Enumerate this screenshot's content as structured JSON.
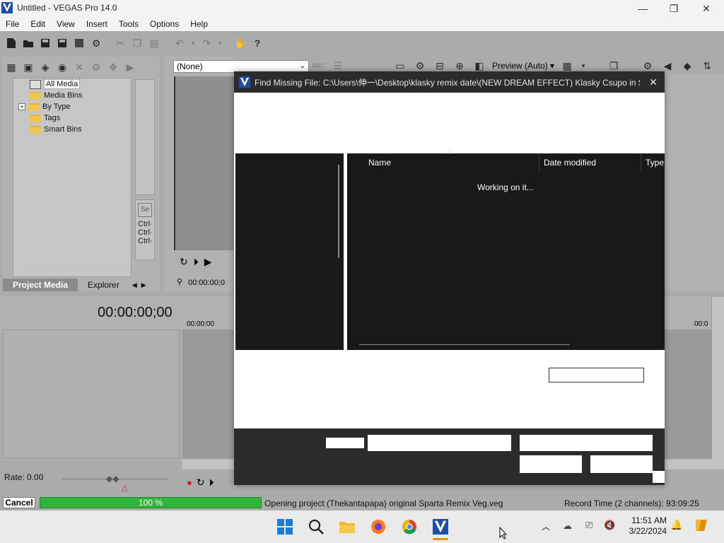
{
  "window": {
    "title": "Untitled - VEGAS Pro 14.0",
    "minimize": "—",
    "maximize": "❐",
    "close": "✕"
  },
  "menu": [
    "File",
    "Edit",
    "View",
    "Insert",
    "Tools",
    "Options",
    "Help"
  ],
  "project_media": {
    "tree": [
      "All Media",
      "Media Bins",
      "By Type",
      "Tags",
      "Smart Bins"
    ],
    "expander": "+",
    "tabs": [
      "Project Media",
      "Explorer"
    ],
    "ctrl_labels": [
      "Ctrl·",
      "Ctrl·",
      "Ctrl·"
    ]
  },
  "preview": {
    "select_value": "(None)",
    "time": "00:00:00;0",
    "mode_label": "Preview (Auto)"
  },
  "timeline": {
    "timecode": "00:00:00;00",
    "ruler_start": "00:00:00",
    "ruler_end": "00:0",
    "rate": "Rate: 0.00"
  },
  "status": {
    "cancel": "Cancel",
    "progress_label": "100 %",
    "progress": 1.0,
    "message": "Opening project (Thekantapapa) original Sparta Remix Veg.veg",
    "record_time": "Record Time (2 channels): 93:09:25"
  },
  "dialog": {
    "title": "Find Missing File: C:\\Users\\伸一\\Desktop\\klasky remix date\\(NEW DREAM EFFECT) Klasky Csupo in Sci...",
    "close": "✕",
    "columns": [
      "Name",
      "Date modified",
      "Type"
    ],
    "sort_arrow": "^",
    "working": "Working on it..."
  },
  "taskbar": {
    "time": "11:51 AM",
    "date": "3/22/2024"
  },
  "colors": {
    "app_bg": "#ababab",
    "dialog_dark": "#191919",
    "progress_green": "#2fb63a"
  }
}
